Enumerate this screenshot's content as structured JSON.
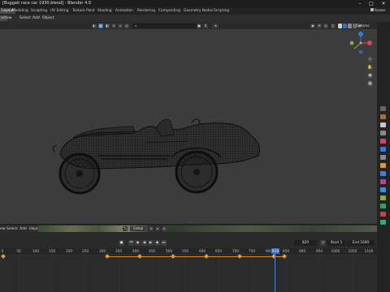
{
  "window": {
    "title": "[Buggati race car 1930.blend] - Blender 4.0",
    "controls": [
      "–",
      "□",
      "✕"
    ]
  },
  "workspaces": {
    "tabs": [
      "Layout",
      "Modeling",
      "Sculpting",
      "UV Editing",
      "Texture Paint",
      "Shading",
      "Animation",
      "Rendering",
      "Compositing",
      "Geometry Nodes",
      "Scripting"
    ],
    "active": "Layout",
    "scene": "Scene"
  },
  "menubar": {
    "items": [
      "Object Mode",
      "View",
      "Select",
      "Add",
      "Object"
    ],
    "visible_labels": [
      "ect",
      "ew",
      "Select",
      "Add",
      "Object"
    ]
  },
  "viewport_header": {
    "orientation": "Global",
    "options_label": "Options"
  },
  "timeline": {
    "menu_items": [
      "ew",
      "Select",
      "Add",
      "Object"
    ],
    "orientation": "Global",
    "current_frame": "820",
    "start_label": "Start",
    "start_value": "1",
    "end_label": "End",
    "end_value": "1600",
    "ruler_ticks": [
      "0",
      "50",
      "100",
      "150",
      "200",
      "250",
      "300",
      "350",
      "400",
      "450",
      "500",
      "550",
      "600",
      "650",
      "700",
      "750",
      "800",
      "850",
      "900",
      "950",
      "1000",
      "1050",
      "1100"
    ],
    "ruler_current": "820"
  },
  "icons": {
    "gizmo_x": "x-axis-gizmo-icon",
    "gizmo_y": "y-axis-gizmo-icon",
    "gizmo_z": "z-axis-gizmo-icon",
    "zoom": "zoom-icon",
    "pan": "pan-hand-icon",
    "camera": "camera-view-icon",
    "ortho": "ortho-grid-icon"
  },
  "colors": {
    "accent_blue": "#3d6fb8",
    "keyframe_orange": "#e0a040",
    "gizmo_x": "#d4495a",
    "gizmo_y": "#7fb23a",
    "gizmo_z": "#3a77d4"
  }
}
